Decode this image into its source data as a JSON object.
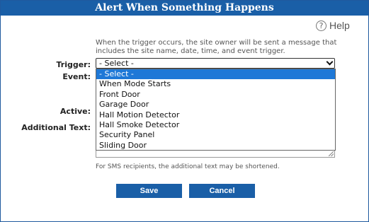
{
  "dialog": {
    "title": "Alert When Something Happens",
    "help_label": "Help",
    "help_icon": "?",
    "description": "When the trigger occurs, the site owner will be sent a message that includes the site name, date, time, and event trigger."
  },
  "form": {
    "trigger_label": "Trigger:",
    "event_label": "Event:",
    "active_label": "Active:",
    "additional_text_label": "Additional Text:",
    "trigger_value": "- Select -",
    "trigger_options": [
      "- Select -",
      "When Mode Starts",
      "Front Door",
      "Garage Door",
      "Hall Motion Detector",
      "Hall Smoke Detector",
      "Security Panel",
      "Sliding Door"
    ],
    "sms_note": "For SMS recipients, the additional text may be shortened."
  },
  "buttons": {
    "save": "Save",
    "cancel": "Cancel"
  },
  "colors": {
    "primary": "#1a5fa7",
    "highlight": "#1e78d7"
  },
  "icons": {
    "help": "help-circle-icon",
    "select_arrow": "chevron-down-icon",
    "resize": "resize-grip-icon"
  }
}
